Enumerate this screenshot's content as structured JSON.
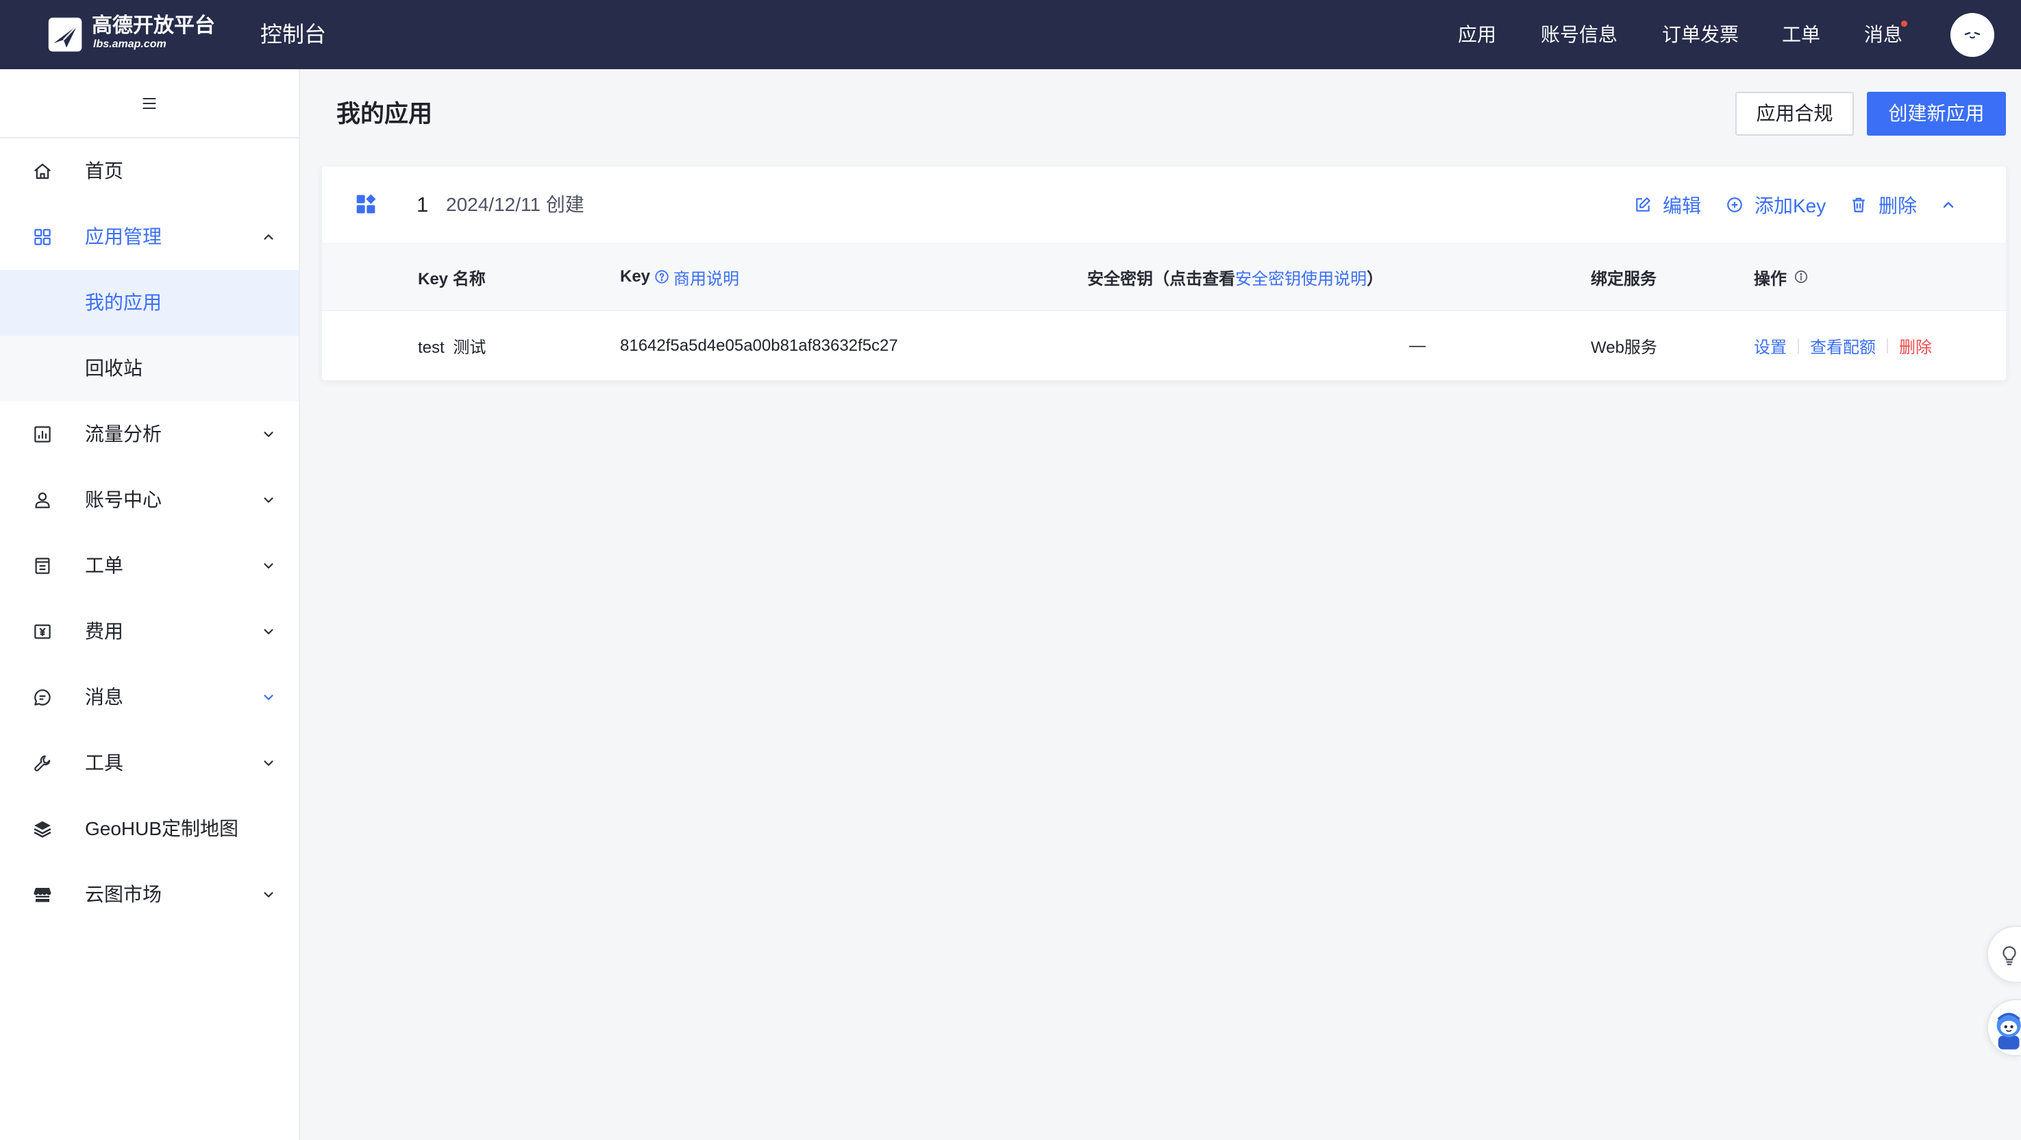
{
  "colors": {
    "header_bg": "#262c4a",
    "accent": "#3b6ff5",
    "danger": "#f24d4d",
    "selected_bg": "#ebf2fe"
  },
  "header": {
    "logo_icon": "amap-logo-icon",
    "logo_title": "高德开放平台",
    "logo_subtitle": "lbs.amap.com",
    "console_label": "控制台",
    "nav": [
      {
        "label": "应用"
      },
      {
        "label": "账号信息"
      },
      {
        "label": "订单发票"
      },
      {
        "label": "工单"
      },
      {
        "label": "消息",
        "unread": true
      }
    ],
    "avatar_icon": "user-avatar-icon"
  },
  "sidebar": {
    "toggle_icon": "hamburger-icon",
    "items": [
      {
        "label": "首页",
        "icon": "home-icon"
      },
      {
        "label": "应用管理",
        "icon": "app-grid-icon",
        "active": true,
        "expanded": true
      },
      {
        "label": "我的应用",
        "level": 2,
        "selected": true
      },
      {
        "label": "回收站",
        "level": 2
      },
      {
        "label": "流量分析",
        "icon": "chart-icon",
        "expandable": true
      },
      {
        "label": "账号中心",
        "icon": "user-icon",
        "expandable": true
      },
      {
        "label": "工单",
        "icon": "ticket-icon",
        "expandable": true
      },
      {
        "label": "费用",
        "icon": "yuan-icon",
        "expandable": true
      },
      {
        "label": "消息",
        "icon": "message-icon",
        "expandable": true
      },
      {
        "label": "工具",
        "icon": "wrench-icon",
        "expandable": true
      },
      {
        "label": "GeoHUB定制地图",
        "icon": "layers-icon"
      },
      {
        "label": "云图市场",
        "icon": "store-icon",
        "expandable": true
      }
    ]
  },
  "main": {
    "title": "我的应用",
    "compliance_button": "应用合规",
    "create_button": "创建新应用",
    "apps": [
      {
        "icon": "app-icon",
        "name": "1",
        "created": "2024/12/11 创建",
        "actions": {
          "edit": "编辑",
          "add_key": "添加Key",
          "delete": "删除"
        },
        "table": {
          "headers": {
            "key_name": "Key 名称",
            "key": "Key",
            "key_help_link": "商用说明",
            "secret_prefix": "安全密钥（点击查看",
            "secret_link": "安全密钥使用说明",
            "secret_suffix": "）",
            "service": "绑定服务",
            "operations": "操作"
          },
          "rows": [
            {
              "key_name": "test 测试",
              "key": "81642f5a5d4e05a00b81af83632f5c27",
              "secret": "—",
              "service": "Web服务",
              "actions": [
                "设置",
                "查看配额",
                "删除"
              ]
            }
          ]
        }
      }
    ]
  },
  "floating": {
    "tips_icon": "lightbulb-icon",
    "assistant_icon": "assistant-mascot-icon"
  }
}
